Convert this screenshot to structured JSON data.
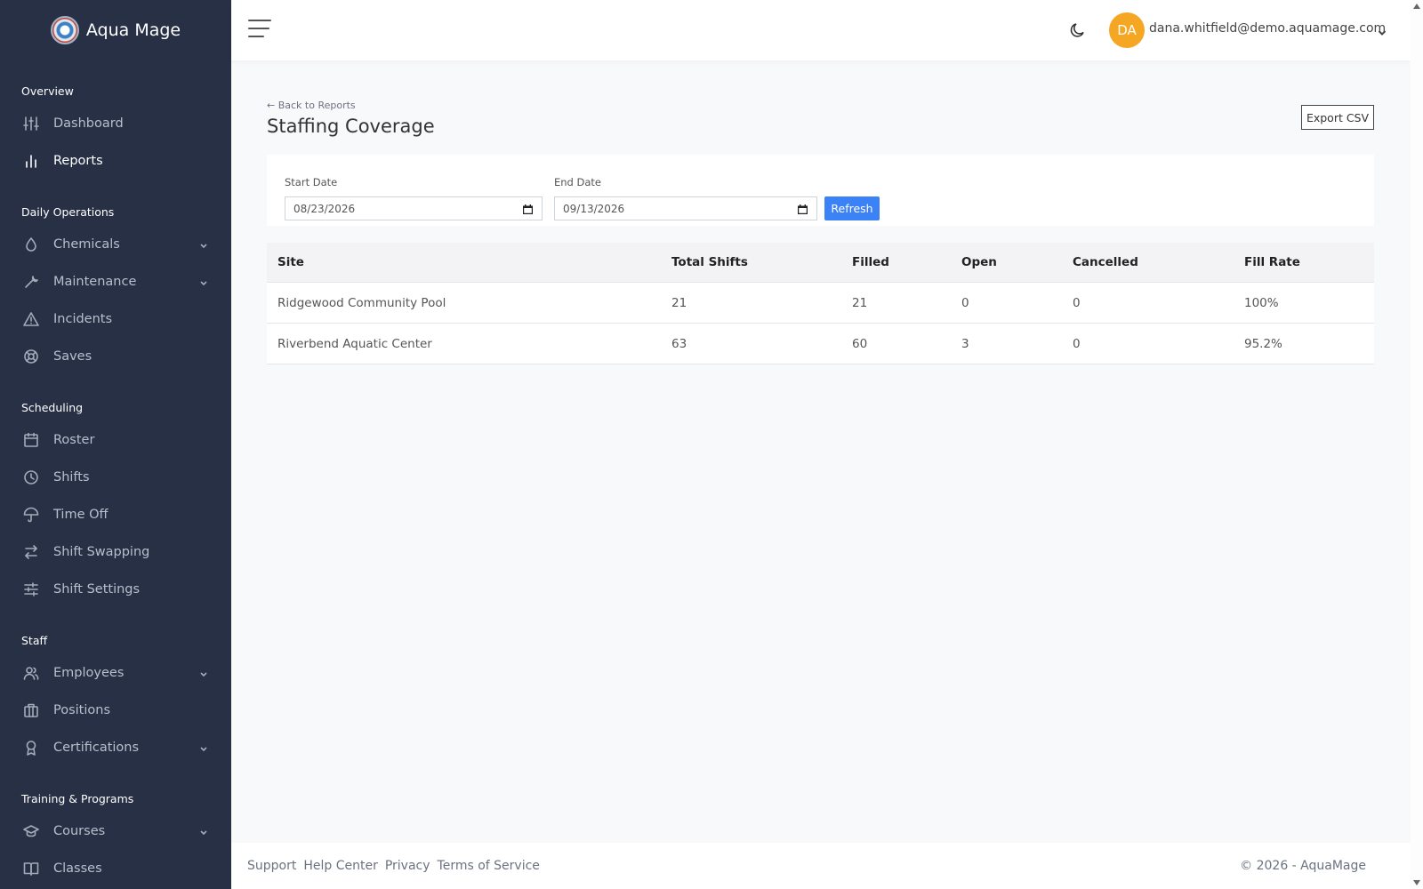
{
  "app": {
    "name": "Aqua Mage"
  },
  "sidebar": {
    "sections": [
      {
        "title": "Overview",
        "items": [
          {
            "label": "Dashboard",
            "icon": "sliders-icon"
          },
          {
            "label": "Reports",
            "icon": "bar-chart-icon",
            "active": true
          }
        ]
      },
      {
        "title": "Daily Operations",
        "items": [
          {
            "label": "Chemicals",
            "icon": "droplet-icon",
            "expandable": true
          },
          {
            "label": "Maintenance",
            "icon": "wrench-icon",
            "expandable": true
          },
          {
            "label": "Incidents",
            "icon": "alert-triangle-icon"
          },
          {
            "label": "Saves",
            "icon": "life-buoy-icon"
          }
        ]
      },
      {
        "title": "Scheduling",
        "items": [
          {
            "label": "Roster",
            "icon": "calendar-icon"
          },
          {
            "label": "Shifts",
            "icon": "clock-icon"
          },
          {
            "label": "Time Off",
            "icon": "umbrella-icon"
          },
          {
            "label": "Shift Swapping",
            "icon": "swap-icon"
          },
          {
            "label": "Shift Settings",
            "icon": "settings-sliders-icon"
          }
        ]
      },
      {
        "title": "Staff",
        "items": [
          {
            "label": "Employees",
            "icon": "users-icon",
            "expandable": true
          },
          {
            "label": "Positions",
            "icon": "briefcase-icon"
          },
          {
            "label": "Certifications",
            "icon": "award-icon",
            "expandable": true
          }
        ]
      },
      {
        "title": "Training & Programs",
        "items": [
          {
            "label": "Courses",
            "icon": "graduation-cap-icon",
            "expandable": true
          },
          {
            "label": "Classes",
            "icon": "book-icon"
          }
        ]
      }
    ]
  },
  "topbar": {
    "avatar_initials": "DA",
    "user_email": "dana.whitfield@demo.aquamage.com",
    "avatar_color": "#f5a623"
  },
  "page": {
    "back_link": "← Back to Reports",
    "title": "Staffing Coverage",
    "export_label": "Export CSV"
  },
  "filters": {
    "start_label": "Start Date",
    "start_value": "08/23/2026",
    "end_label": "End Date",
    "end_value": "09/13/2026",
    "refresh_label": "Refresh"
  },
  "table": {
    "columns": [
      "Site",
      "Total Shifts",
      "Filled",
      "Open",
      "Cancelled",
      "Fill Rate"
    ],
    "rows": [
      [
        "Ridgewood Community Pool",
        "21",
        "21",
        "0",
        "0",
        "100%"
      ],
      [
        "Riverbend Aquatic Center",
        "63",
        "60",
        "3",
        "0",
        "95.2%"
      ]
    ]
  },
  "footer": {
    "links": [
      "Support",
      "Help Center",
      "Privacy",
      "Terms of Service"
    ],
    "copyright": "© 2026 - AquaMage"
  },
  "colors": {
    "sidebar_bg": "#283046",
    "accent": "#3b82f6"
  }
}
